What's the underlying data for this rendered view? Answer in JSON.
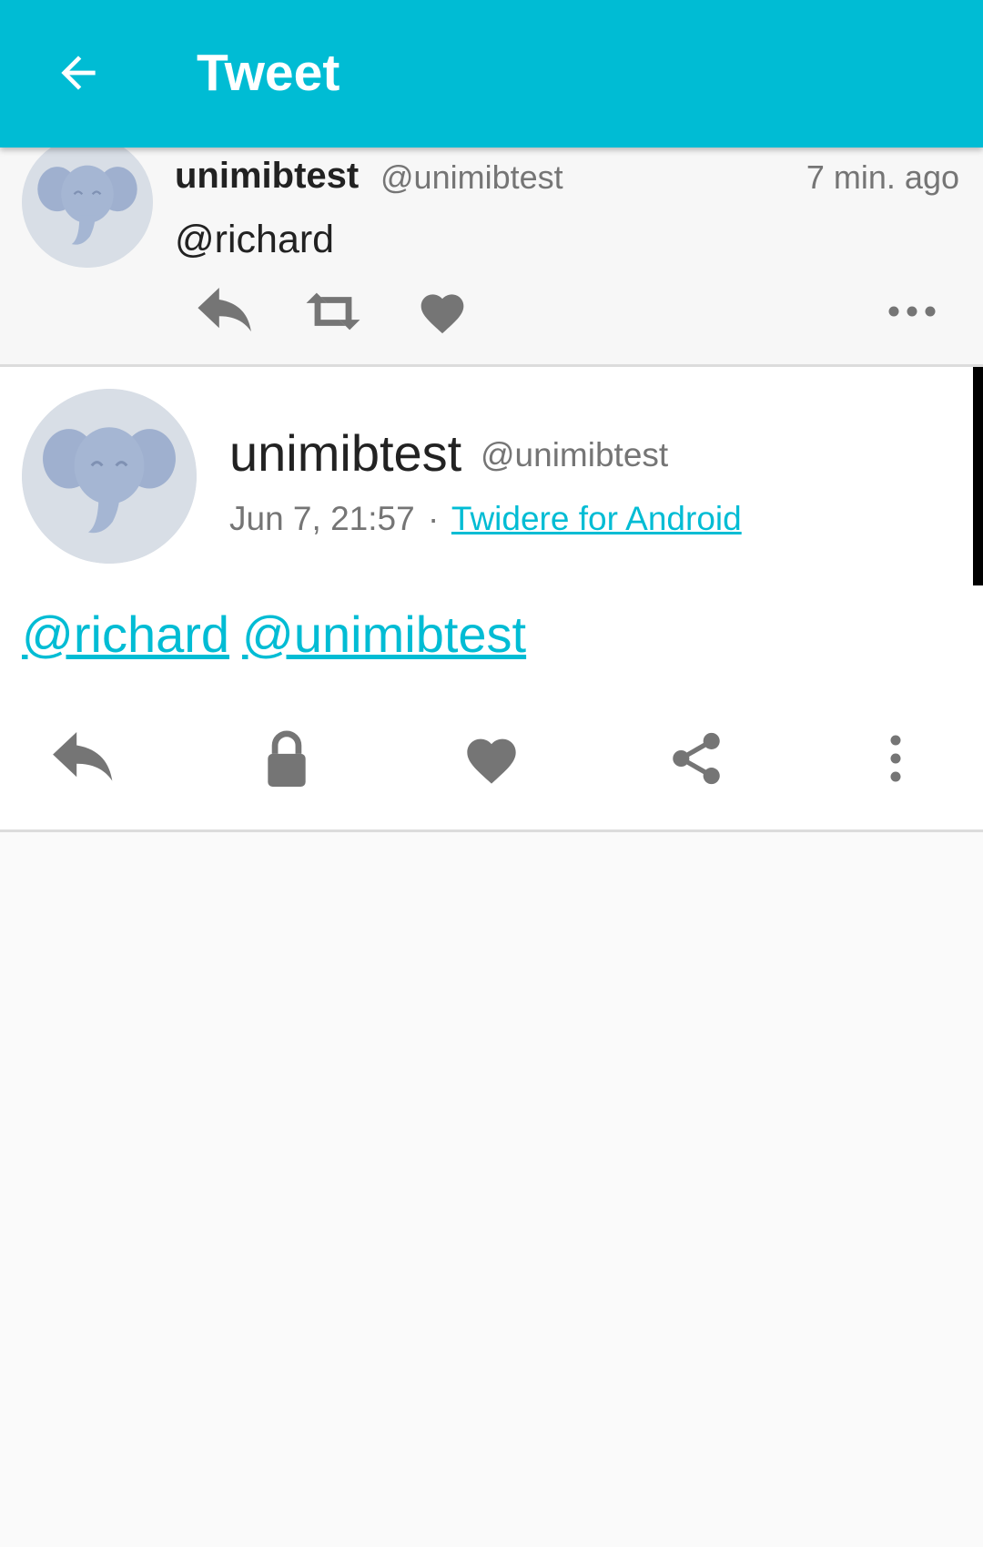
{
  "app_bar": {
    "title": "Tweet",
    "back_icon": "arrow-back-icon",
    "background": "#00bcd4"
  },
  "parent_tweet": {
    "name": "unimibtest",
    "handle": "@unimibtest",
    "time": "7 min. ago",
    "text": "@richard",
    "actions": [
      "reply-icon",
      "retweet-icon",
      "heart-icon",
      "more-horizontal-icon"
    ]
  },
  "main_tweet": {
    "name": "unimibtest",
    "handle": "@unimibtest",
    "date": "Jun 7, 21:57",
    "separator": "·",
    "source": "Twidere for Android",
    "mentions": [
      "@richard",
      "@unimibtest"
    ],
    "actions": [
      "reply-icon",
      "lock-icon",
      "heart-icon",
      "share-icon",
      "more-vertical-icon"
    ]
  },
  "colors": {
    "accent": "#00bcd4",
    "icon_gray": "#757575",
    "text_dark": "#222222"
  }
}
